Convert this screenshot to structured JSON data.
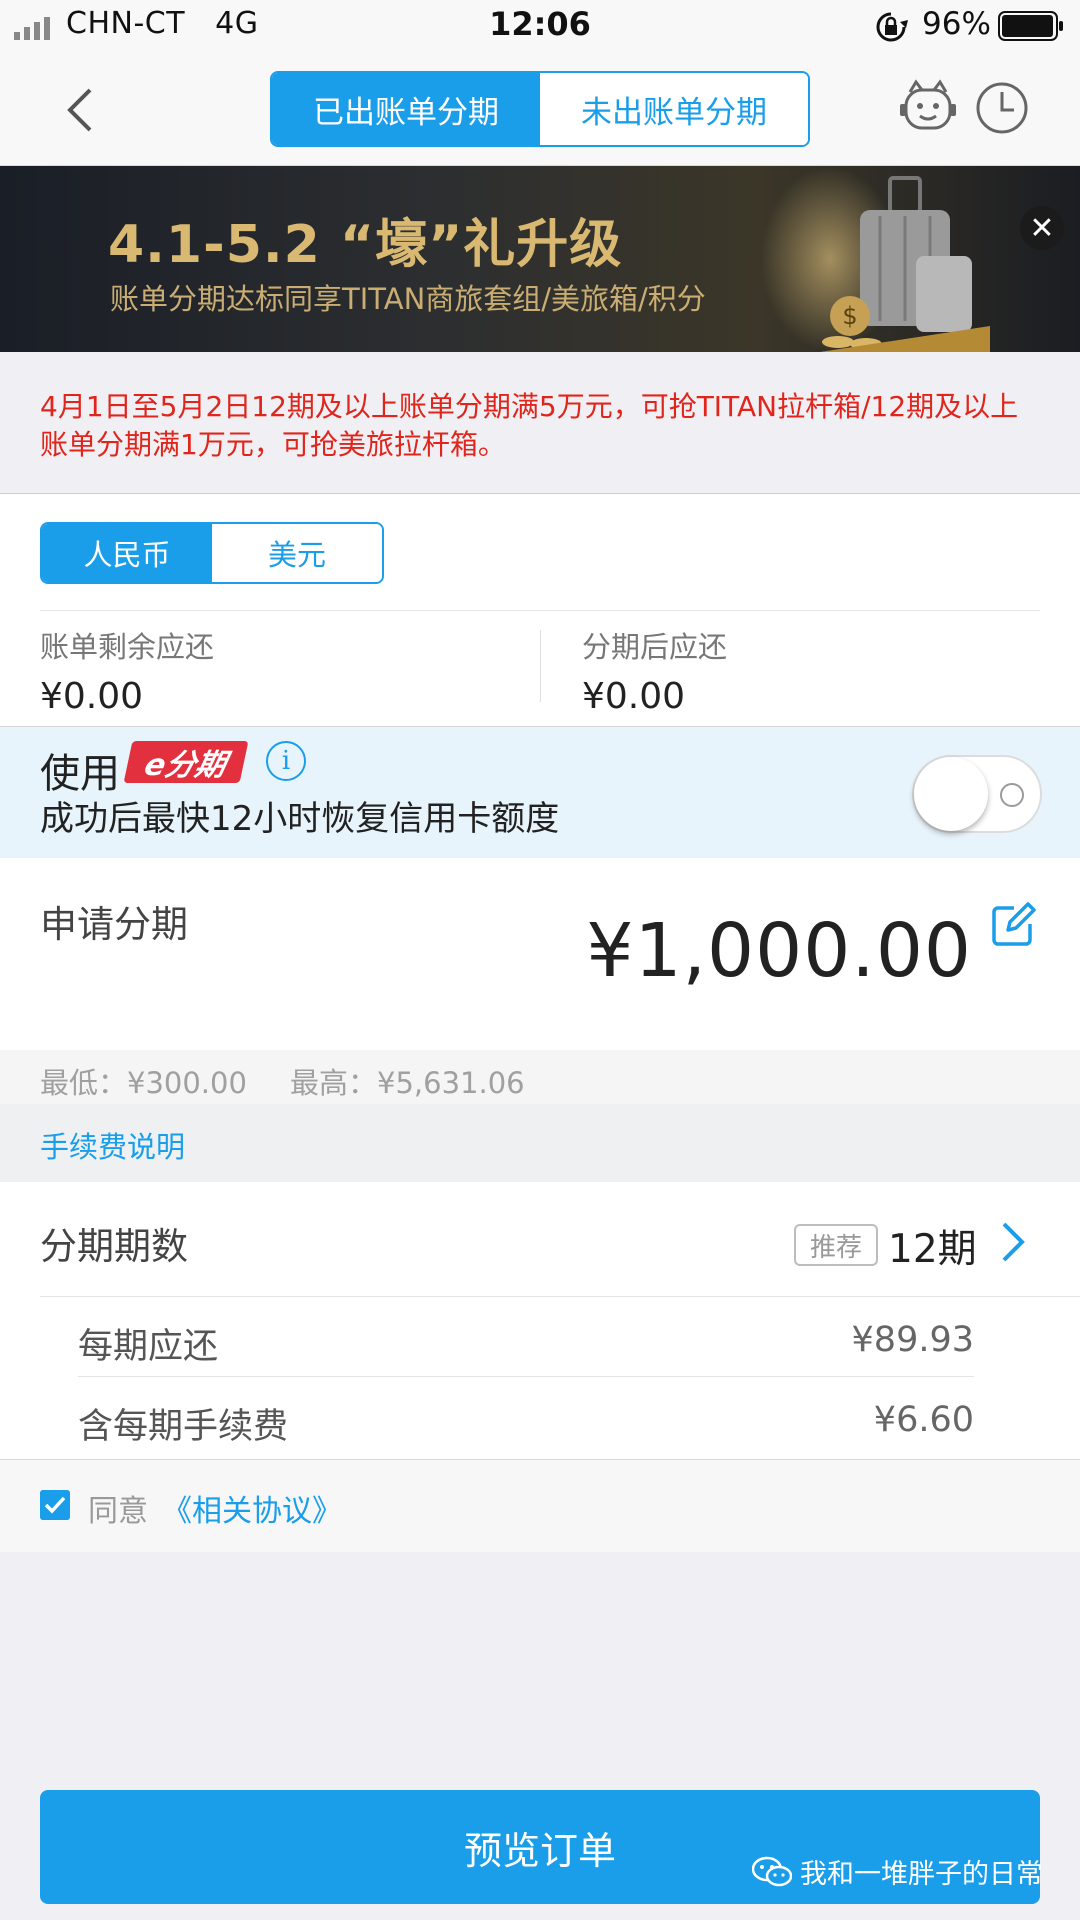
{
  "status_bar": {
    "carrier": "CHN-CT",
    "network": "4G",
    "time": "12:06",
    "battery": "96%"
  },
  "nav": {
    "tabs": [
      "已出账单分期",
      "未出账单分期"
    ],
    "selected_tab": 0
  },
  "banner": {
    "title": "4.1-5.2 “壕”礼升级",
    "subtitle": "账单分期达标同享TITAN商旅套组/美旅箱/积分",
    "close_label": "✕"
  },
  "notice": {
    "text": "4月1日至5月2日12期及以上账单分期满5万元，可抢TITAN拉杆箱/12期及以上账单分期满1万元，可抢美旅拉杆箱。"
  },
  "currency": {
    "options": [
      "人民币",
      "美元"
    ],
    "selected": 0
  },
  "balance": {
    "remaining_label": "账单剩余应还",
    "remaining_value": "¥0.00",
    "after_label": "分期后应还",
    "after_value": "¥0.00"
  },
  "efenqi": {
    "use_label": "使用",
    "logo_text": "e分期",
    "info_symbol": "i",
    "description": "成功后最快12小时恢复信用卡额度",
    "enabled": false
  },
  "apply": {
    "label": "申请分期",
    "amount": "¥1,000.00"
  },
  "range": {
    "min": "最低：¥300.00",
    "max": "最高：¥5,631.06"
  },
  "fee_link": "手续费说明",
  "installments": {
    "label": "分期期数",
    "badge": "推荐",
    "period": "12期",
    "per_period_label": "每期应还",
    "per_period_value": "¥89.93",
    "fee_label": "含每期手续费",
    "fee_value": "¥6.60"
  },
  "agreement": {
    "checked": true,
    "text": "同意",
    "link": "《相关协议》"
  },
  "preview_button": "预览订单",
  "watermark": "我和一堆胖子的日常",
  "colors": {
    "accent": "#1a9ee9",
    "notice_red": "#e0261c",
    "efenqi_red": "#e3303f"
  }
}
